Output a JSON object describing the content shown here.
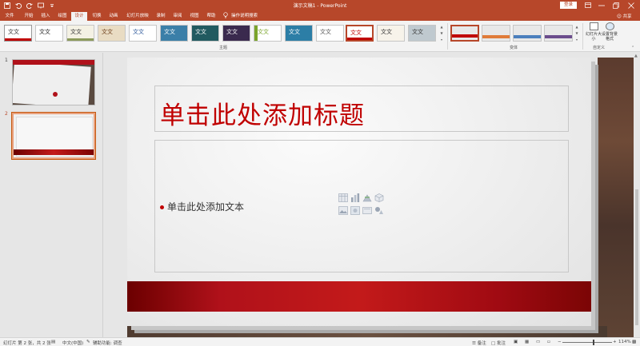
{
  "titlebar": {
    "doc_title": "演示文稿1  -  PowerPoint",
    "login_label": "登录",
    "icons": [
      "save-icon",
      "undo-icon",
      "redo-icon",
      "start-slideshow-icon",
      "customize-qat-icon",
      "ribbon-display-icon",
      "minimize-icon",
      "restore-icon",
      "close-icon"
    ]
  },
  "tabs": [
    {
      "label": "文件"
    },
    {
      "label": "开始"
    },
    {
      "label": "插入"
    },
    {
      "label": "绘图"
    },
    {
      "label": "设计",
      "active": true
    },
    {
      "label": "切换"
    },
    {
      "label": "动画"
    },
    {
      "label": "幻灯片放映"
    },
    {
      "label": "录制"
    },
    {
      "label": "审阅"
    },
    {
      "label": "视图"
    },
    {
      "label": "帮助"
    }
  ],
  "tell_me": "操作说明搜索",
  "share_label": "共享",
  "ribbon": {
    "themes_group_label": "主题",
    "variants_group_label": "变体",
    "customize_group_label": "自定义",
    "theme_thumb_text": "文文",
    "slide_size_label": "幻灯片大小",
    "format_background_label": "设置背景格式",
    "accent_color": "#b7472a"
  },
  "slides_panel": {
    "slides": [
      {
        "number": "1"
      },
      {
        "number": "2",
        "selected": true
      }
    ]
  },
  "slide": {
    "title_placeholder": "单击此处添加标题",
    "body_placeholder": "单击此处添加文本",
    "accent_color": "#c00000"
  },
  "statusbar": {
    "slide_info": "幻灯片 第 2 张，共 2 张",
    "language": "中文(中国)",
    "accessibility": "辅助功能: 调查",
    "notes_label": "备注",
    "comments_label": "批注",
    "zoom": "114%"
  }
}
